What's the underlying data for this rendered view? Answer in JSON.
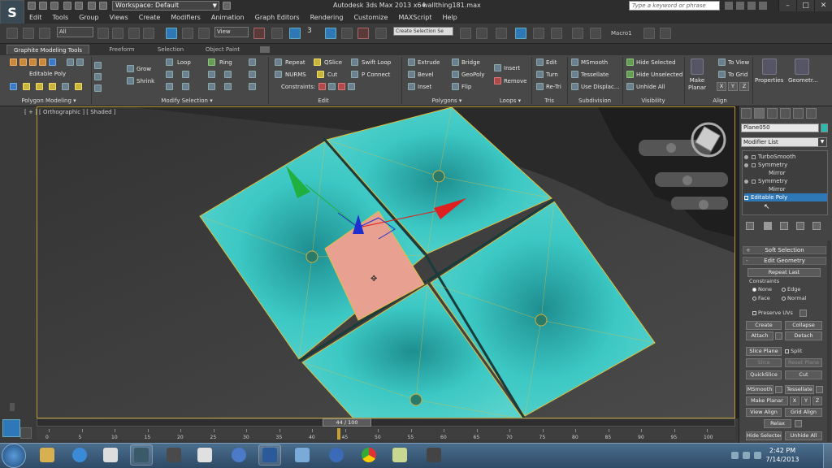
{
  "titlebar": {
    "workspace_label": "Workspace: Default",
    "app_title": "Autodesk 3ds Max  2013 x64",
    "file_name": "wallthing181.max",
    "search_placeholder": "Type a keyword or phrase"
  },
  "menus": [
    "Edit",
    "Tools",
    "Group",
    "Views",
    "Create",
    "Modifiers",
    "Animation",
    "Graph Editors",
    "Rendering",
    "Customize",
    "MAXScript",
    "Help"
  ],
  "toolbar": {
    "filter_value": "All",
    "refcoord_value": "View",
    "angle_snap_label": "3",
    "selection_set_value": "Create Selection Se",
    "macro_label": "Macro1"
  },
  "ribbon_tabs": [
    "Graphite Modeling Tools",
    "Freeform",
    "Selection",
    "Object Paint"
  ],
  "ribbon": {
    "polygon_modeling": {
      "label": "Polygon Modeling",
      "editable_poly": "Editable Poly"
    },
    "modify_selection": {
      "label": "Modify Selection",
      "grow": "Grow",
      "shrink": "Shrink",
      "loop": "Loop",
      "ring": "Ring"
    },
    "edit": {
      "label": "Edit",
      "repeat": "Repeat",
      "qslice": "QSlice",
      "swift_loop": "Swift Loop",
      "nurms": "NURMS",
      "cut": "Cut",
      "p_connect": "P Connect",
      "constraints": "Constraints:"
    },
    "polygons": {
      "label": "Polygons",
      "extrude": "Extrude",
      "bridge": "Bridge",
      "bevel": "Bevel",
      "geopoly": "GeoPoly",
      "inset": "Inset",
      "flip": "Flip",
      "insert": "Insert",
      "remove": "Remove"
    },
    "loops": {
      "label": "Loops"
    },
    "tris": {
      "label": "Tris",
      "edit": "Edit",
      "turn": "Turn",
      "retri": "Re-Tri"
    },
    "subdivision": {
      "label": "Subdivision",
      "msmooth": "MSmooth",
      "tessellate": "Tessellate",
      "use_displace": "Use Displac..."
    },
    "visibility": {
      "label": "Visibility",
      "hide_selected": "Hide Selected",
      "hide_unselected": "Hide Unselected",
      "unhide_all": "Unhide All"
    },
    "make_planar": [
      "Make",
      "Planar"
    ],
    "align": {
      "label": "Align",
      "to_view": "To View",
      "to_grid": "To Grid",
      "x": "X",
      "y": "Y",
      "z": "Z"
    },
    "properties": "Properties",
    "geometry": "Geometr..."
  },
  "viewport": {
    "label": "[ + ] [ Orthographic ] [ Shaded ]"
  },
  "command_panel": {
    "object_name": "Plane050",
    "object_color": "#2bbab0",
    "modifier_list": "Modifier List",
    "stack": [
      {
        "label": "TurboSmooth",
        "indent": false,
        "selected": false
      },
      {
        "label": "Symmetry",
        "indent": false,
        "selected": false
      },
      {
        "label": "Mirror",
        "indent": true,
        "selected": false
      },
      {
        "label": "Symmetry",
        "indent": false,
        "selected": false
      },
      {
        "label": "Mirror",
        "indent": true,
        "selected": false
      },
      {
        "label": "Editable Poly",
        "indent": false,
        "selected": true
      }
    ],
    "soft_selection": "Soft Selection",
    "edit_geometry": "Edit Geometry",
    "repeat_last": "Repeat Last",
    "constraints_label": "Constraints",
    "c_none": "None",
    "c_edge": "Edge",
    "c_face": "Face",
    "c_normal": "Normal",
    "preserve_uvs": "Preserve UVs",
    "create": "Create",
    "collapse": "Collapse",
    "attach": "Attach",
    "detach": "Detach",
    "slice_plane": "Slice Plane",
    "split": "Split",
    "slice": "Slice",
    "reset_plane": "Reset Plane",
    "quickslice": "QuickSlice",
    "cut": "Cut",
    "msmooth": "MSmooth",
    "tessellate": "Tessellate",
    "make_planar": "Make Planar",
    "x": "X",
    "y": "Y",
    "z": "Z",
    "view_align": "View Align",
    "grid_align": "Grid Align",
    "relax": "Relax",
    "hide_selected": "Hide Selected",
    "unhide_all": "Unhide All"
  },
  "timeline": {
    "frame_label": "44 / 100",
    "current_frame": 44,
    "total_frames": 100,
    "ticks": [
      "0",
      "5",
      "10",
      "15",
      "20",
      "25",
      "30",
      "35",
      "40",
      "45",
      "50",
      "55",
      "60",
      "65",
      "70",
      "75",
      "80",
      "85",
      "90",
      "95",
      "100"
    ]
  },
  "taskbar": {
    "time": "2:42 PM",
    "date": "7/14/2013"
  },
  "colors": {
    "mesh": "#36c4c0",
    "selection": "#e8a090",
    "gizmo_x": "#e02020",
    "gizmo_y": "#20b040",
    "gizmo_z": "#2030d0",
    "accent": "#2f78b8"
  }
}
